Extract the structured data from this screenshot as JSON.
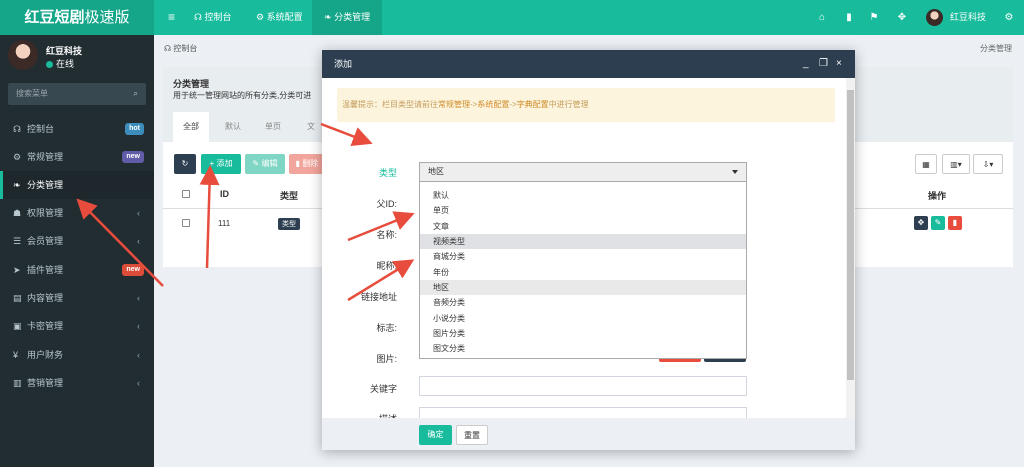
{
  "logo": {
    "brand": "红豆短剧",
    "suffix": "极速版"
  },
  "topnav": {
    "menu_toggle": "≡",
    "items": [
      {
        "icon": "☊",
        "label": "控制台"
      },
      {
        "icon": "⚙",
        "label": "系统配置"
      },
      {
        "icon": "❧",
        "label": "分类管理"
      }
    ],
    "user_name": "红豆科技",
    "right_icons": [
      "home-icon",
      "trash-icon",
      "language-icon",
      "fullscreen-icon",
      "settings-icon"
    ]
  },
  "sidebar": {
    "user_name": "红豆科技",
    "status": "在线",
    "search_placeholder": "搜索菜单",
    "search_icon": "⌕",
    "items": [
      {
        "icon": "☊",
        "label": "控制台",
        "badge": "hot",
        "badge_color": "#3c8dbc"
      },
      {
        "icon": "⚙",
        "label": "常规管理",
        "badge": "new",
        "badge_color": "#605ca8"
      },
      {
        "icon": "❧",
        "label": "分类管理"
      },
      {
        "icon": "☗",
        "label": "权限管理",
        "chevron": "‹"
      },
      {
        "icon": "☰",
        "label": "会员管理",
        "chevron": "‹"
      },
      {
        "icon": "➤",
        "label": "插件管理",
        "badge": "new",
        "badge_color": "#dd4b39"
      },
      {
        "icon": "▤",
        "label": "内容管理",
        "chevron": "‹"
      },
      {
        "icon": "▣",
        "label": "卡密管理",
        "chevron": "‹"
      },
      {
        "icon": "¥",
        "label": "用户财务",
        "chevron": "‹"
      },
      {
        "icon": "▥",
        "label": "营销管理",
        "chevron": "‹"
      }
    ]
  },
  "breadcrumb": {
    "home": "控制台",
    "current": "分类管理"
  },
  "panel": {
    "title": "分类管理",
    "description": "用于统一管理网站的所有分类,分类可进",
    "tabs": [
      "全部",
      "默认",
      "单页",
      "文"
    ],
    "toolbar": {
      "refresh": "↻",
      "add": "添加",
      "edit": "编辑",
      "delete": "删除"
    },
    "columns": [
      "ID",
      "类型",
      "操作"
    ],
    "row": {
      "id": "111",
      "type": "类型"
    }
  },
  "modal": {
    "title": "添加",
    "controls": [
      "_",
      "❐",
      "×"
    ],
    "tip_prefix": "温馨提示：栏目类型请前往",
    "tip_link1": "常规管理",
    "tip_arrow1": "->",
    "tip_link2": "系统配置",
    "tip_arrow2": "->",
    "tip_link3": "字典配置",
    "tip_suffix": "中进行管理",
    "labels": {
      "type": "类型",
      "parent": "父ID:",
      "name": "名称:",
      "nickname": "昵称:",
      "link": "链接地址",
      "flag": "标志:",
      "image": "图片:",
      "keywords": "关键字",
      "description": "描述"
    },
    "select_value": "地区",
    "options": [
      "默认",
      "单页",
      "文章",
      "视频类型",
      "商城分类",
      "年份",
      "地区",
      "音频分类",
      "小说分类",
      "图片分类",
      "图文分类"
    ],
    "confirm": "确定",
    "reset": "重置"
  },
  "colors": {
    "primary": "#18bc9c",
    "sidebar": "#222d32",
    "modal_header": "#2c3e50",
    "danger": "#e74c3c"
  }
}
